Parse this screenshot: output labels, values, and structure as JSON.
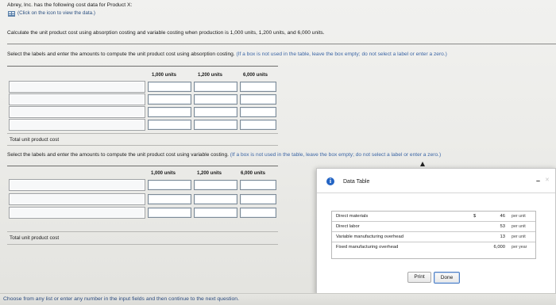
{
  "intro": {
    "line1": "Abrey, Inc. has the following cost data for Product X:",
    "icon_link": "(Click on the icon to view the data.)",
    "calc": "Calculate the unit product cost using absorption costing and variable costing when production is 1,000 units, 1,200 units, and 6,000 units."
  },
  "absorption": {
    "instruction": "Select the labels and enter the amounts to compute the unit product cost using absorption costing.",
    "note": "(If a box is not used in the table, leave the box empty; do not select a label or enter a zero.)",
    "col_headers": [
      "1,000 units",
      "1,200 units",
      "6,000 units"
    ],
    "total_label": "Total unit product cost"
  },
  "variable": {
    "instruction": "Select the labels and enter the amounts to compute the unit product cost using variable costing.",
    "note": "(If a box is not used in the table, leave the box empty; do not select a label or enter a zero.)",
    "col_headers": [
      "1,000 units",
      "1,200 units",
      "6,000 units"
    ],
    "total_label": "Total unit product cost"
  },
  "popup": {
    "title": "Data Table",
    "minimize": "–",
    "close": "✕",
    "rows": [
      {
        "label": "Direct materials",
        "currency": "$",
        "value": "46",
        "unit": "per unit"
      },
      {
        "label": "Direct labor",
        "currency": "",
        "value": "53",
        "unit": "per unit"
      },
      {
        "label": "Variable manufacturing overhead",
        "currency": "",
        "value": "13",
        "unit": "per unit"
      },
      {
        "label": "Fixed manufacturing overhead",
        "currency": "",
        "value": "6,000",
        "unit": "per year"
      }
    ],
    "print_label": "Print",
    "done_label": "Done"
  },
  "footer": {
    "text": "Choose from any list or enter any number in the input fields and then continue to the next question."
  }
}
